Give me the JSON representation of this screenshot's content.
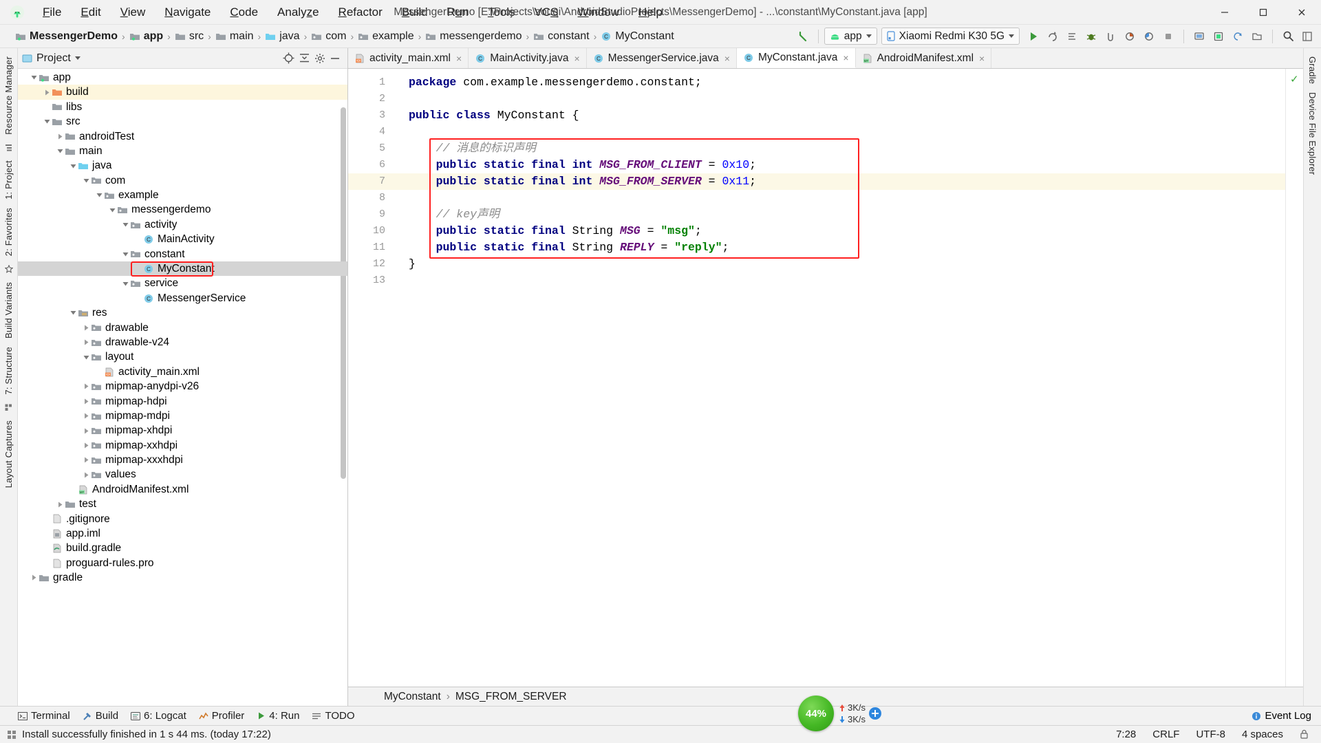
{
  "window": {
    "title": "MessengerDemo [E:\\Projects\\zouqi\\AndroidStudioProjects\\MessengerDemo] - ...\\constant\\MyConstant.java [app]",
    "minimize": "—",
    "maximize": "▢",
    "close": "✕"
  },
  "menubar": [
    {
      "label": "File",
      "mnemonic": "F"
    },
    {
      "label": "Edit",
      "mnemonic": "E"
    },
    {
      "label": "View",
      "mnemonic": "V"
    },
    {
      "label": "Navigate",
      "mnemonic": "N"
    },
    {
      "label": "Code",
      "mnemonic": "C"
    },
    {
      "label": "Analyze",
      "mnemonic": "z"
    },
    {
      "label": "Refactor",
      "mnemonic": "R"
    },
    {
      "label": "Build",
      "mnemonic": "B"
    },
    {
      "label": "Run",
      "mnemonic": "u"
    },
    {
      "label": "Tools",
      "mnemonic": "T"
    },
    {
      "label": "VCS",
      "mnemonic": "S"
    },
    {
      "label": "Window",
      "mnemonic": "W"
    },
    {
      "label": "Help",
      "mnemonic": "H"
    }
  ],
  "breadcrumb": {
    "items": [
      {
        "label": "MessengerDemo",
        "icon": "module-icon",
        "bold": true
      },
      {
        "label": "app",
        "icon": "module-icon",
        "bold": true
      },
      {
        "label": "src",
        "icon": "folder-icon",
        "bold": false
      },
      {
        "label": "main",
        "icon": "folder-icon",
        "bold": false
      },
      {
        "label": "java",
        "icon": "source-folder-icon",
        "bold": false
      },
      {
        "label": "com",
        "icon": "package-icon",
        "bold": false
      },
      {
        "label": "example",
        "icon": "package-icon",
        "bold": false
      },
      {
        "label": "messengerdemo",
        "icon": "package-icon",
        "bold": false
      },
      {
        "label": "constant",
        "icon": "package-icon",
        "bold": false
      },
      {
        "label": "MyConstant",
        "icon": "class-icon",
        "bold": false
      }
    ],
    "separator": "›"
  },
  "toolbar": {
    "run_config": "app",
    "device": "Xiaomi Redmi K30 5G",
    "buttons": [
      {
        "name": "run-button",
        "glyph": "▶"
      },
      {
        "name": "apply-changes-button",
        "glyph": "↻"
      },
      {
        "name": "apply-code-changes-button",
        "glyph": "≡"
      },
      {
        "name": "debug-button",
        "glyph": "☣"
      },
      {
        "name": "attach-debugger-button",
        "glyph": "⌘"
      },
      {
        "name": "run-with-coverage-button",
        "glyph": "◴"
      },
      {
        "name": "profile-button",
        "glyph": "◔"
      },
      {
        "name": "stop-button",
        "glyph": "■"
      },
      {
        "name": "avd-manager-button",
        "glyph": "▣"
      },
      {
        "name": "sdk-manager-button",
        "glyph": "⊞"
      },
      {
        "name": "sync-gradle-button",
        "glyph": "↺"
      },
      {
        "name": "device-file-explorer-button",
        "glyph": "⯈"
      },
      {
        "name": "search-everywhere-button",
        "glyph": "⌕"
      },
      {
        "name": "layout-inspector-button",
        "glyph": "◫"
      }
    ]
  },
  "sidebar_left": {
    "labels": [
      "Resource Manager",
      "1: Project",
      "2: Favorites",
      "Build Variants",
      "7: Structure",
      "Layout Captures"
    ]
  },
  "sidebar_right": {
    "labels": [
      "Gradle",
      "Device File Explorer"
    ]
  },
  "project_panel": {
    "title": "Project",
    "tree": [
      {
        "label": "app",
        "depth": 1,
        "state": "open",
        "icon": "module-icon",
        "hl": false,
        "sel": false
      },
      {
        "label": "build",
        "depth": 2,
        "state": "closed",
        "icon": "build-folder-icon",
        "hl": true,
        "sel": false
      },
      {
        "label": "libs",
        "depth": 2,
        "state": "leaf",
        "icon": "folder-icon",
        "hl": false,
        "sel": false
      },
      {
        "label": "src",
        "depth": 2,
        "state": "open",
        "icon": "folder-icon",
        "hl": false,
        "sel": false
      },
      {
        "label": "androidTest",
        "depth": 3,
        "state": "closed",
        "icon": "folder-icon",
        "hl": false,
        "sel": false
      },
      {
        "label": "main",
        "depth": 3,
        "state": "open",
        "icon": "folder-icon",
        "hl": false,
        "sel": false
      },
      {
        "label": "java",
        "depth": 4,
        "state": "open",
        "icon": "source-folder-icon",
        "hl": false,
        "sel": false
      },
      {
        "label": "com",
        "depth": 5,
        "state": "open",
        "icon": "package-icon",
        "hl": false,
        "sel": false
      },
      {
        "label": "example",
        "depth": 6,
        "state": "open",
        "icon": "package-icon",
        "hl": false,
        "sel": false
      },
      {
        "label": "messengerdemo",
        "depth": 7,
        "state": "open",
        "icon": "package-icon",
        "hl": false,
        "sel": false
      },
      {
        "label": "activity",
        "depth": 8,
        "state": "open",
        "icon": "package-icon",
        "hl": false,
        "sel": false
      },
      {
        "label": "MainActivity",
        "depth": 9,
        "state": "leaf",
        "icon": "class-icon",
        "hl": false,
        "sel": false
      },
      {
        "label": "constant",
        "depth": 8,
        "state": "open",
        "icon": "package-icon",
        "hl": false,
        "sel": false
      },
      {
        "label": "MyConstant",
        "depth": 9,
        "state": "leaf",
        "icon": "class-icon",
        "hl": false,
        "sel": true
      },
      {
        "label": "service",
        "depth": 8,
        "state": "open",
        "icon": "package-icon",
        "hl": false,
        "sel": false
      },
      {
        "label": "MessengerService",
        "depth": 9,
        "state": "leaf",
        "icon": "class-icon",
        "hl": false,
        "sel": false
      },
      {
        "label": "res",
        "depth": 4,
        "state": "open",
        "icon": "res-folder-icon",
        "hl": false,
        "sel": false
      },
      {
        "label": "drawable",
        "depth": 5,
        "state": "closed",
        "icon": "package-icon",
        "hl": false,
        "sel": false
      },
      {
        "label": "drawable-v24",
        "depth": 5,
        "state": "closed",
        "icon": "package-icon",
        "hl": false,
        "sel": false
      },
      {
        "label": "layout",
        "depth": 5,
        "state": "open",
        "icon": "package-icon",
        "hl": false,
        "sel": false
      },
      {
        "label": "activity_main.xml",
        "depth": 6,
        "state": "leaf",
        "icon": "xml-layout-icon",
        "hl": false,
        "sel": false
      },
      {
        "label": "mipmap-anydpi-v26",
        "depth": 5,
        "state": "closed",
        "icon": "package-icon",
        "hl": false,
        "sel": false
      },
      {
        "label": "mipmap-hdpi",
        "depth": 5,
        "state": "closed",
        "icon": "package-icon",
        "hl": false,
        "sel": false
      },
      {
        "label": "mipmap-mdpi",
        "depth": 5,
        "state": "closed",
        "icon": "package-icon",
        "hl": false,
        "sel": false
      },
      {
        "label": "mipmap-xhdpi",
        "depth": 5,
        "state": "closed",
        "icon": "package-icon",
        "hl": false,
        "sel": false
      },
      {
        "label": "mipmap-xxhdpi",
        "depth": 5,
        "state": "closed",
        "icon": "package-icon",
        "hl": false,
        "sel": false
      },
      {
        "label": "mipmap-xxxhdpi",
        "depth": 5,
        "state": "closed",
        "icon": "package-icon",
        "hl": false,
        "sel": false
      },
      {
        "label": "values",
        "depth": 5,
        "state": "closed",
        "icon": "package-icon",
        "hl": false,
        "sel": false
      },
      {
        "label": "AndroidManifest.xml",
        "depth": 4,
        "state": "leaf",
        "icon": "manifest-icon",
        "hl": false,
        "sel": false
      },
      {
        "label": "test",
        "depth": 3,
        "state": "closed",
        "icon": "folder-icon",
        "hl": false,
        "sel": false
      },
      {
        "label": ".gitignore",
        "depth": 2,
        "state": "leaf",
        "icon": "file-icon",
        "hl": false,
        "sel": false
      },
      {
        "label": "app.iml",
        "depth": 2,
        "state": "leaf",
        "icon": "iml-icon",
        "hl": false,
        "sel": false
      },
      {
        "label": "build.gradle",
        "depth": 2,
        "state": "leaf",
        "icon": "gradle-icon",
        "hl": false,
        "sel": false
      },
      {
        "label": "proguard-rules.pro",
        "depth": 2,
        "state": "leaf",
        "icon": "file-icon",
        "hl": false,
        "sel": false
      },
      {
        "label": "gradle",
        "depth": 1,
        "state": "closed",
        "icon": "folder-icon",
        "hl": false,
        "sel": false
      }
    ]
  },
  "editor": {
    "tabs": [
      {
        "label": "activity_main.xml",
        "icon": "xml-layout-icon",
        "active": false
      },
      {
        "label": "MainActivity.java",
        "icon": "class-icon",
        "active": false
      },
      {
        "label": "MessengerService.java",
        "icon": "class-icon",
        "active": false
      },
      {
        "label": "MyConstant.java",
        "icon": "class-icon",
        "active": true
      },
      {
        "label": "AndroidManifest.xml",
        "icon": "manifest-icon",
        "active": false
      }
    ],
    "close_glyph": "×",
    "current_line": 7,
    "line_numbers": [
      "1",
      "2",
      "3",
      "4",
      "5",
      "6",
      "7",
      "8",
      "9",
      "10",
      "11",
      "12",
      "13"
    ],
    "inspection_status": "✓",
    "code_lines": [
      {
        "n": 1,
        "tokens": [
          {
            "t": "package ",
            "c": "kw"
          },
          {
            "t": "com.example.messengerdemo.constant;",
            "c": "pl"
          }
        ]
      },
      {
        "n": 2,
        "tokens": []
      },
      {
        "n": 3,
        "tokens": [
          {
            "t": "public class ",
            "c": "kw"
          },
          {
            "t": "MyConstant {",
            "c": "pl"
          }
        ]
      },
      {
        "n": 4,
        "tokens": []
      },
      {
        "n": 5,
        "tokens": [
          {
            "t": "    // 消息的标识声明",
            "c": "cm"
          }
        ]
      },
      {
        "n": 6,
        "tokens": [
          {
            "t": "    ",
            "c": "pl"
          },
          {
            "t": "public static final int ",
            "c": "kw"
          },
          {
            "t": "MSG_FROM_CLIENT",
            "c": "cnst"
          },
          {
            "t": " = ",
            "c": "pl"
          },
          {
            "t": "0x10",
            "c": "num"
          },
          {
            "t": ";",
            "c": "pl"
          }
        ]
      },
      {
        "n": 7,
        "tokens": [
          {
            "t": "    ",
            "c": "pl"
          },
          {
            "t": "public static final int ",
            "c": "kw"
          },
          {
            "t": "MSG_FROM_SERVER",
            "c": "cnst"
          },
          {
            "t": " = ",
            "c": "pl"
          },
          {
            "t": "0x11",
            "c": "num"
          },
          {
            "t": ";",
            "c": "pl"
          }
        ]
      },
      {
        "n": 8,
        "tokens": []
      },
      {
        "n": 9,
        "tokens": [
          {
            "t": "    // key声明",
            "c": "cm"
          }
        ]
      },
      {
        "n": 10,
        "tokens": [
          {
            "t": "    ",
            "c": "pl"
          },
          {
            "t": "public static final ",
            "c": "kw"
          },
          {
            "t": "String ",
            "c": "pl"
          },
          {
            "t": "MSG",
            "c": "cnst"
          },
          {
            "t": " = ",
            "c": "pl"
          },
          {
            "t": "\"msg\"",
            "c": "st"
          },
          {
            "t": ";",
            "c": "pl"
          }
        ]
      },
      {
        "n": 11,
        "tokens": [
          {
            "t": "    ",
            "c": "pl"
          },
          {
            "t": "public static final ",
            "c": "kw"
          },
          {
            "t": "String ",
            "c": "pl"
          },
          {
            "t": "REPLY",
            "c": "cnst"
          },
          {
            "t": " = ",
            "c": "pl"
          },
          {
            "t": "\"reply\"",
            "c": "st"
          },
          {
            "t": ";",
            "c": "pl"
          }
        ]
      },
      {
        "n": 12,
        "tokens": [
          {
            "t": "}",
            "c": "pl"
          }
        ]
      },
      {
        "n": 13,
        "tokens": []
      }
    ],
    "bottom_breadcrumb": [
      "MyConstant",
      "MSG_FROM_SERVER"
    ],
    "bottom_breadcrumb_sep": "›"
  },
  "bottom_toolwindows": [
    {
      "label": "Terminal",
      "icon": "terminal-icon"
    },
    {
      "label": "Build",
      "icon": "hammer-icon"
    },
    {
      "label": "6: Logcat",
      "icon": "logcat-icon"
    },
    {
      "label": "Profiler",
      "icon": "profiler-icon"
    },
    {
      "label": "4: Run",
      "icon": "run-icon"
    },
    {
      "label": "TODO",
      "icon": "todo-icon"
    }
  ],
  "event_log": {
    "label": "Event Log",
    "icon": "info-icon"
  },
  "memory_widget": {
    "percent": "44%",
    "upload_rate": "3K/s",
    "download_rate": "3K/s"
  },
  "statusbar": {
    "message": "Install successfully finished in 1 s 44 ms. (today 17:22)",
    "caret": "7:28",
    "line_separator": "CRLF",
    "encoding": "UTF-8",
    "indent": "4 spaces"
  },
  "colors": {
    "accent_green": "#3ddc84",
    "highlight_red": "#ff2020",
    "selection_gray": "#d4d4d4",
    "current_line_yellow": "#fcf8e6",
    "keyword_navy": "#000080",
    "constant_purple": "#660e7a",
    "string_green": "#008000",
    "number_blue": "#0000ff",
    "comment_gray": "#8c8c8c"
  }
}
